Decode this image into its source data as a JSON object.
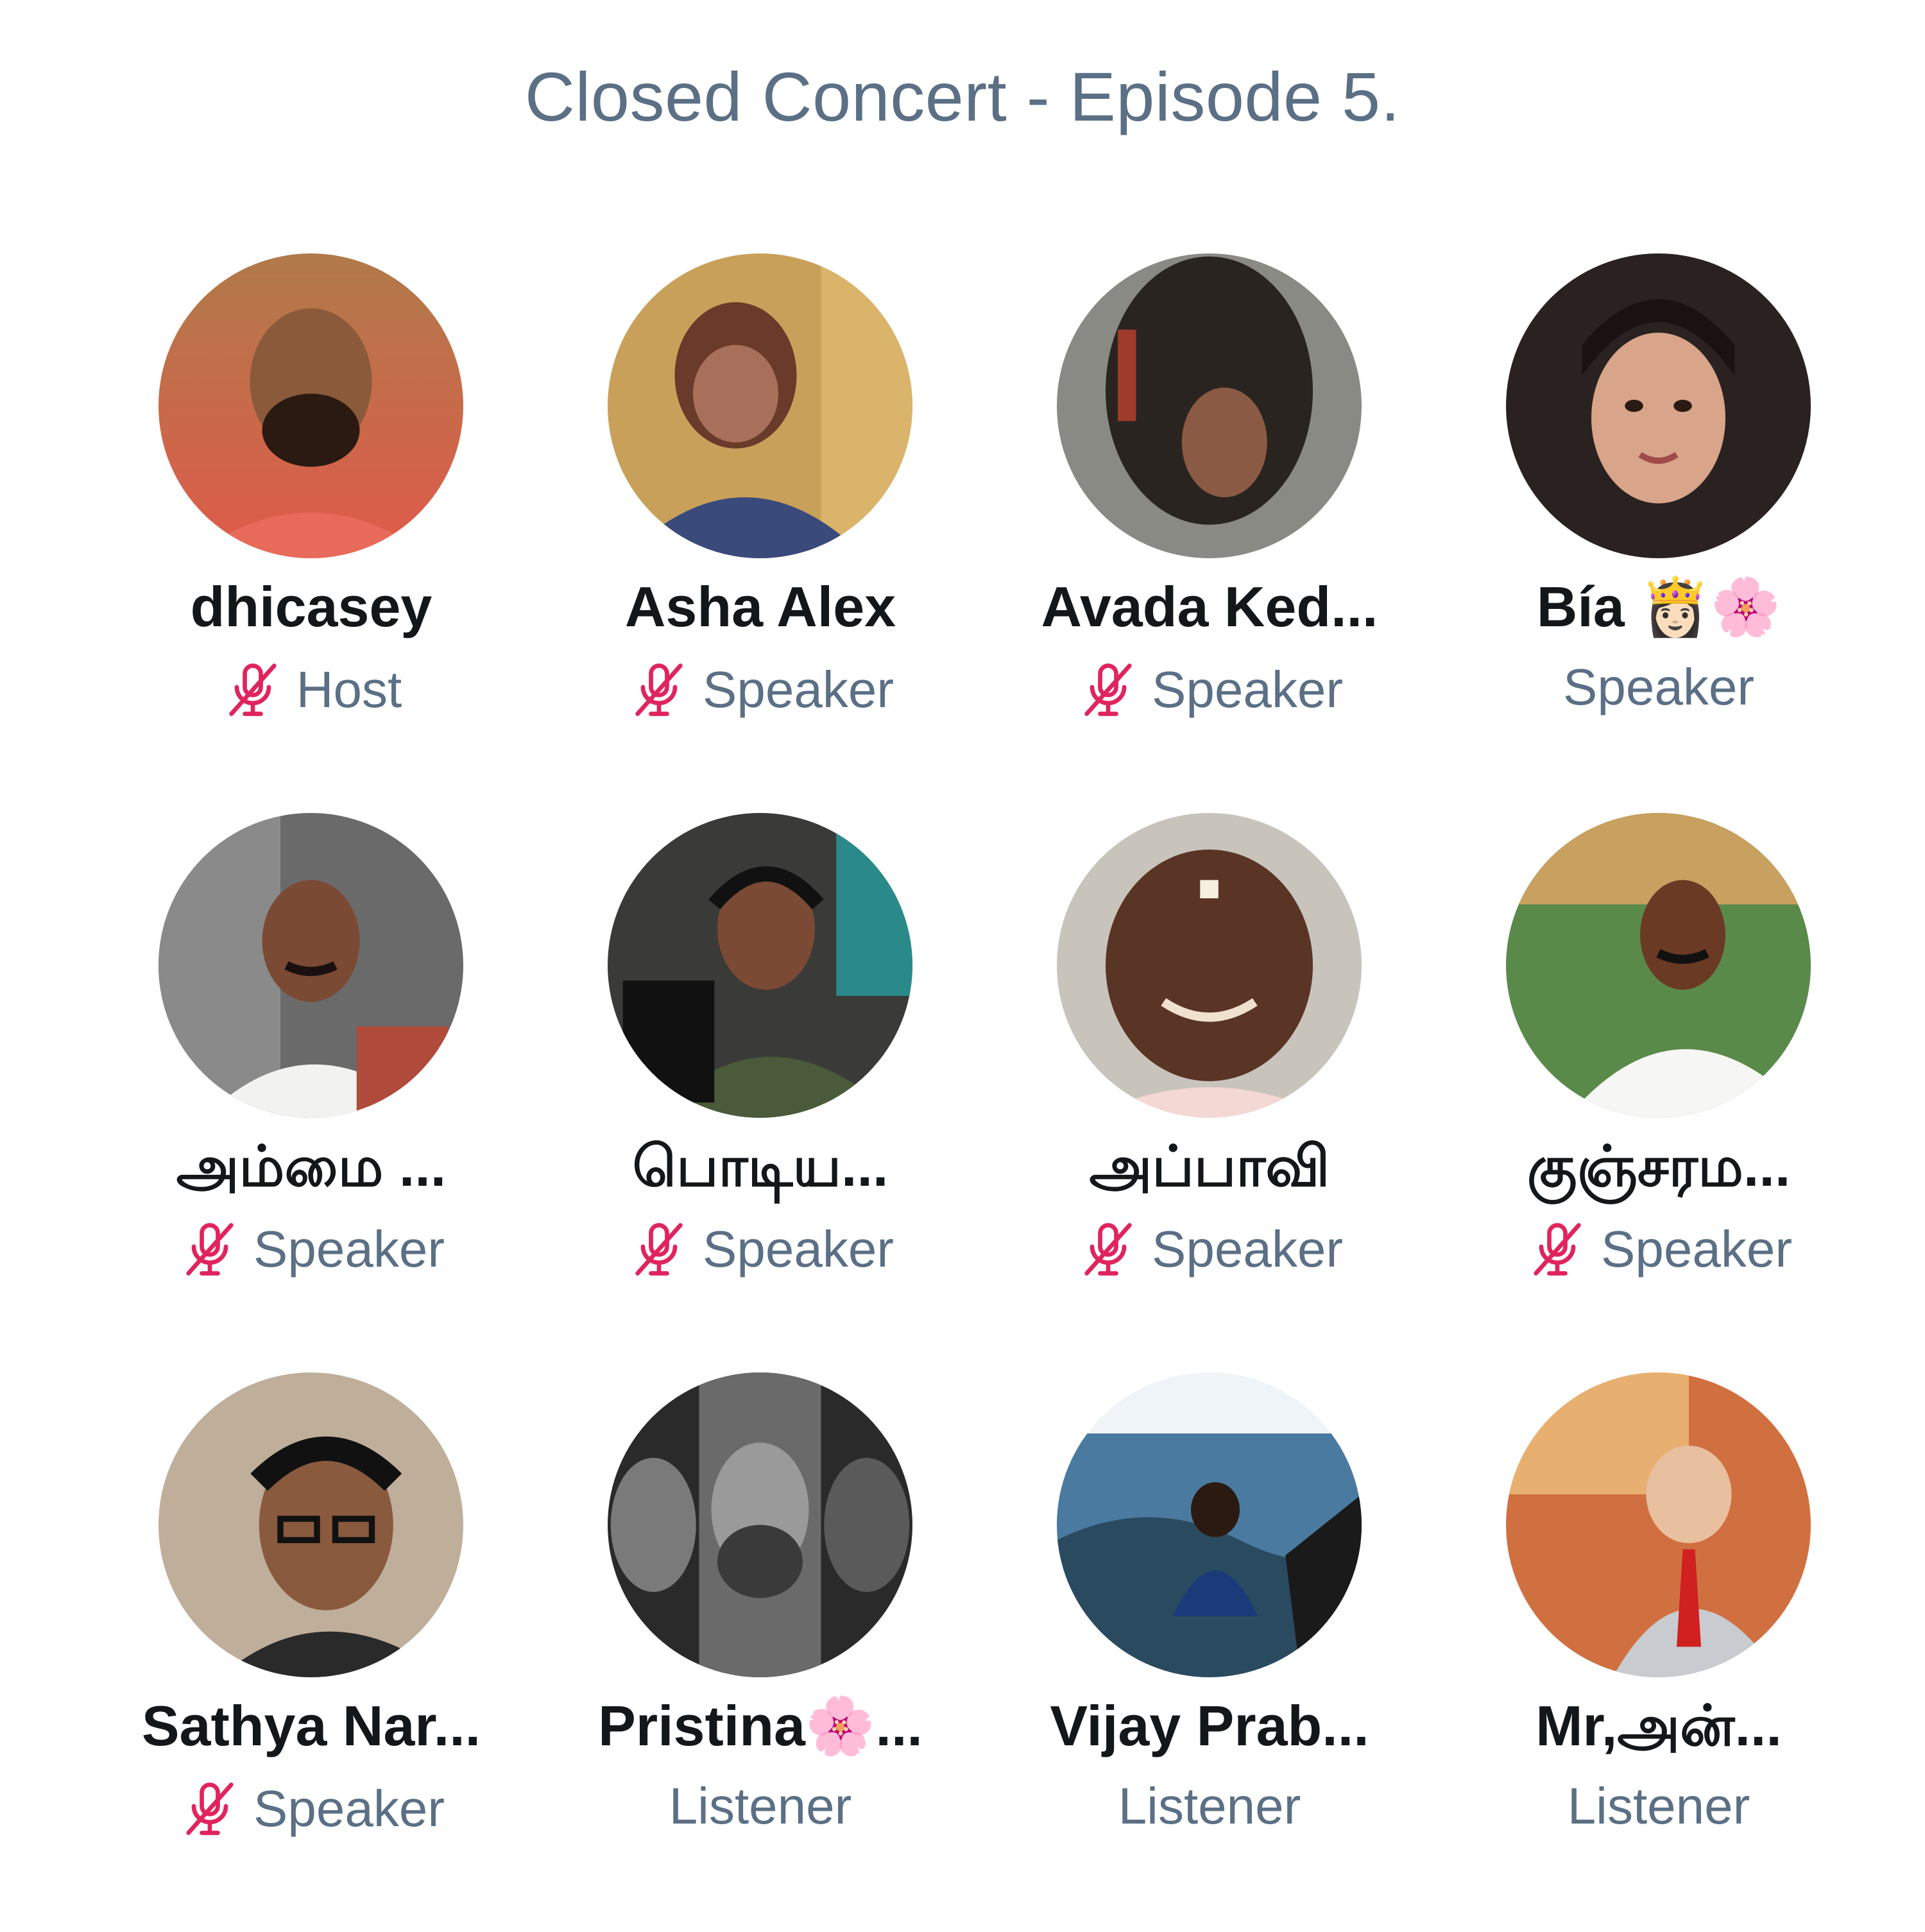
{
  "space": {
    "title": "Closed Concert - Episode 5."
  },
  "participants": [
    {
      "name": "dhicasey",
      "role": "Host",
      "muted": true
    },
    {
      "name": "Asha Alex",
      "role": "Speaker",
      "muted": true
    },
    {
      "name": "Avada Ked...",
      "role": "Speaker",
      "muted": true
    },
    {
      "name": "Bía 👸🏻🌸",
      "role": "Speaker",
      "muted": false
    },
    {
      "name": "அம்மை ...",
      "role": "Speaker",
      "muted": true
    },
    {
      "name": "பொடிய...",
      "role": "Speaker",
      "muted": true
    },
    {
      "name": "அப்பாவி",
      "role": "Speaker",
      "muted": true
    },
    {
      "name": "குஞ்சரம...",
      "role": "Speaker",
      "muted": true
    },
    {
      "name": "Sathya Nar...",
      "role": "Speaker",
      "muted": true
    },
    {
      "name": "Pristina🌸...",
      "role": "Listener",
      "muted": false
    },
    {
      "name": "Vijay Prab...",
      "role": "Listener",
      "muted": false
    },
    {
      "name": "Mr,அன்...",
      "role": "Listener",
      "muted": false
    }
  ],
  "colors": {
    "title": "#5b6f85",
    "name": "#14171a",
    "role": "#5b6f85",
    "muted_icon": "#e0245e"
  },
  "icons": {
    "muted": "mic-muted-icon"
  }
}
